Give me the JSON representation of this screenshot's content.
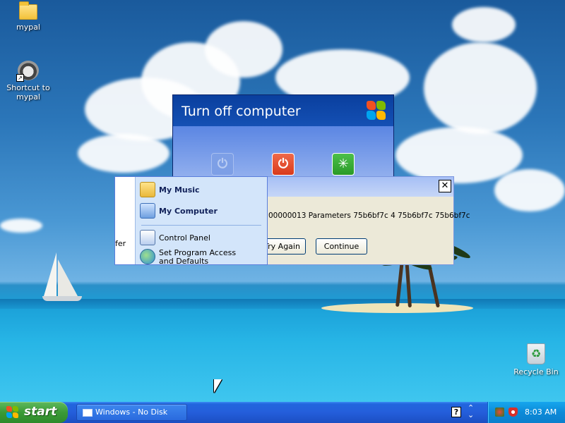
{
  "desktop": {
    "icons": [
      {
        "label": "mypal"
      },
      {
        "label": "Shortcut to mypal"
      },
      {
        "label": "Recycle Bin"
      }
    ]
  },
  "turnoff_dialog": {
    "title": "Turn off computer"
  },
  "error_dialog": {
    "close_glyph": "✕",
    "message": "00000013 Parameters 75b6bf7c 4 75b6bf7c 75b6bf7c",
    "try_again_label": "Try Again",
    "continue_label": "Continue"
  },
  "start_menu": {
    "left_fragment": "fer",
    "items": [
      {
        "label": "My Music"
      },
      {
        "label": "My Computer"
      },
      {
        "label": "Control Panel"
      },
      {
        "label": "Set Program Access and Defaults"
      }
    ]
  },
  "taskbar": {
    "start_label": "start",
    "window_button_label": "Windows - No Disk",
    "help_glyph": "?",
    "clock": "8:03 AM"
  },
  "colors": {
    "xp_blue": "#245edb",
    "start_green": "#3a9a36",
    "tray_blue": "#0c8ad8",
    "dialog_face": "#ece9d8"
  }
}
